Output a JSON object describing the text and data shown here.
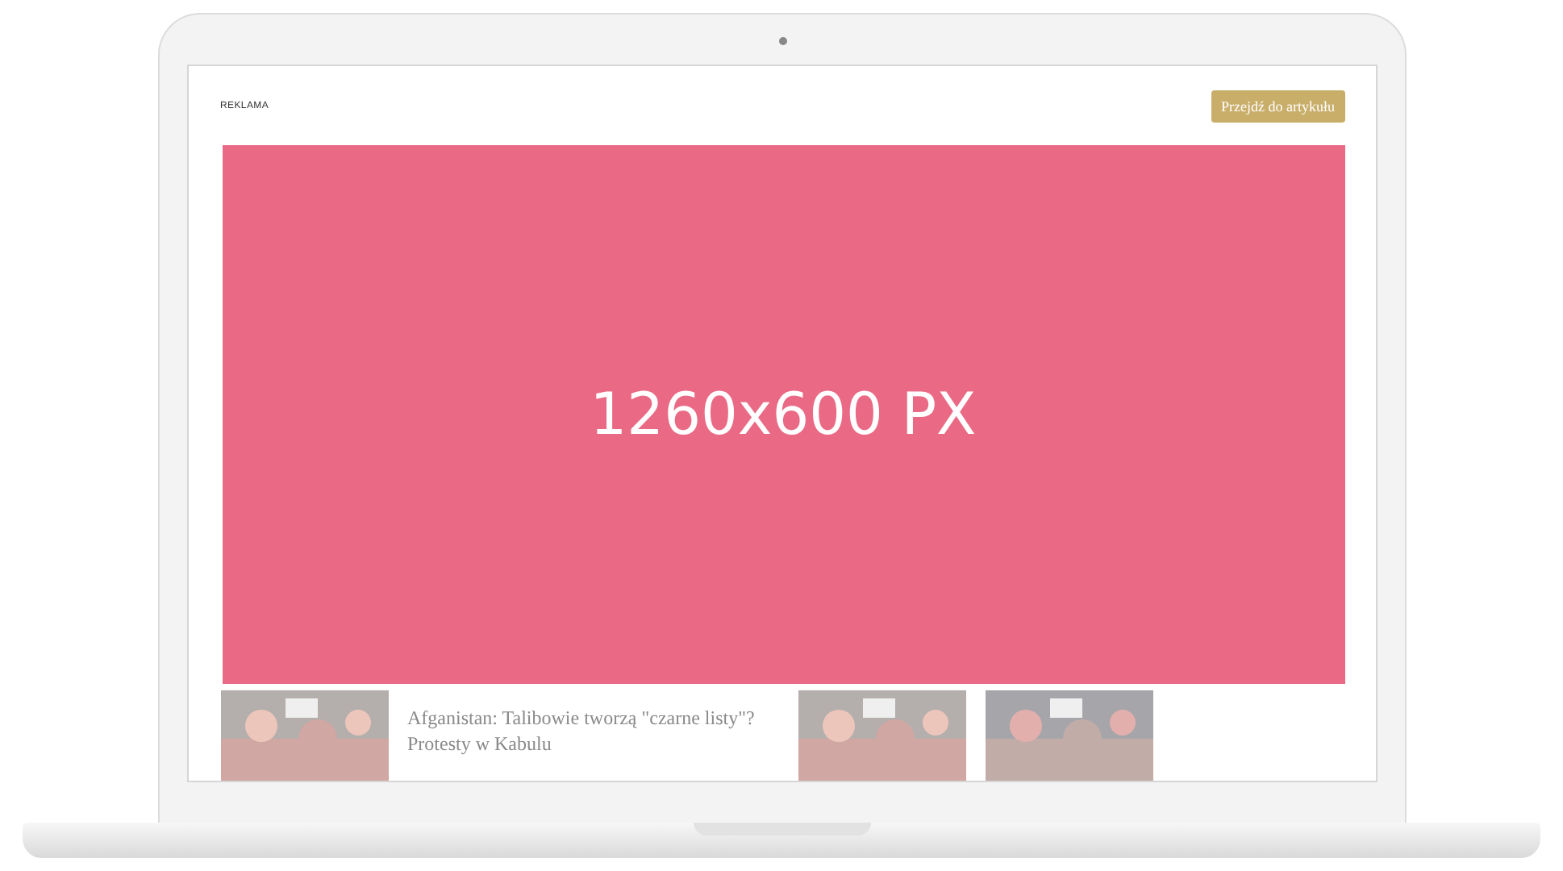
{
  "ad_bar": {
    "label": "REKLAMA",
    "skip_button": "Przejdź do artykułu"
  },
  "ad_placeholder": {
    "size_text": "1260x600 PX"
  },
  "articles": [
    {
      "kind": "picture"
    },
    {
      "kind": "headline",
      "text": "Afganistan: Talibowie tworzą \"czarne listy\"? Protesty w Kabulu"
    },
    {
      "kind": "picture"
    },
    {
      "kind": "picture"
    }
  ]
}
